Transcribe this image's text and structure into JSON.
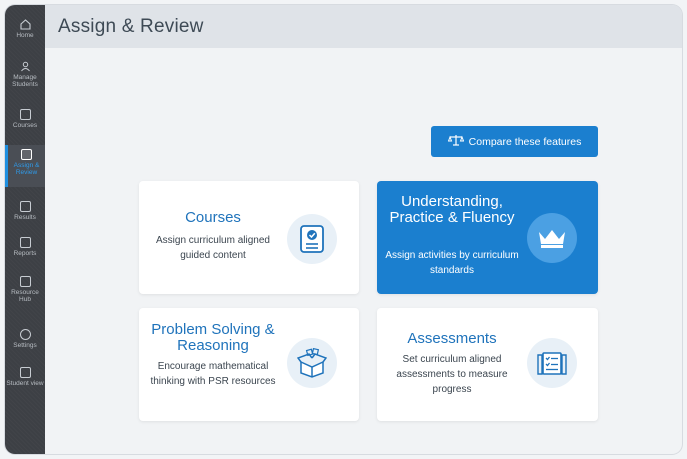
{
  "sidebar": {
    "items": [
      {
        "label": "Home"
      },
      {
        "label": "Manage Students"
      },
      {
        "label": "Courses"
      },
      {
        "label": "Assign & Review"
      },
      {
        "label": "Results"
      },
      {
        "label": "Reports"
      },
      {
        "label": "Resource Hub"
      },
      {
        "label": "Settings"
      },
      {
        "label": "Student view"
      }
    ]
  },
  "header": {
    "title": "Assign & Review"
  },
  "compare": {
    "label": "Compare these features"
  },
  "cards": [
    {
      "title": "Courses",
      "desc": "Assign curriculum aligned guided content",
      "icon": "certificate-icon"
    },
    {
      "title": "Understanding, Practice & Fluency",
      "desc": "Assign activities by curriculum standards",
      "icon": "crown-icon"
    },
    {
      "title": "Problem Solving & Reasoning",
      "desc": "Encourage mathematical thinking with PSR resources",
      "icon": "open-box-icon"
    },
    {
      "title": "Assessments",
      "desc": "Set curriculum aligned assessments to measure progress",
      "icon": "checklist-icon"
    }
  ],
  "colors": {
    "accent": "#1b7fcf",
    "sidebar": "#3d4045",
    "header": "#dfe3e8",
    "title_text": "#1f73bb"
  }
}
